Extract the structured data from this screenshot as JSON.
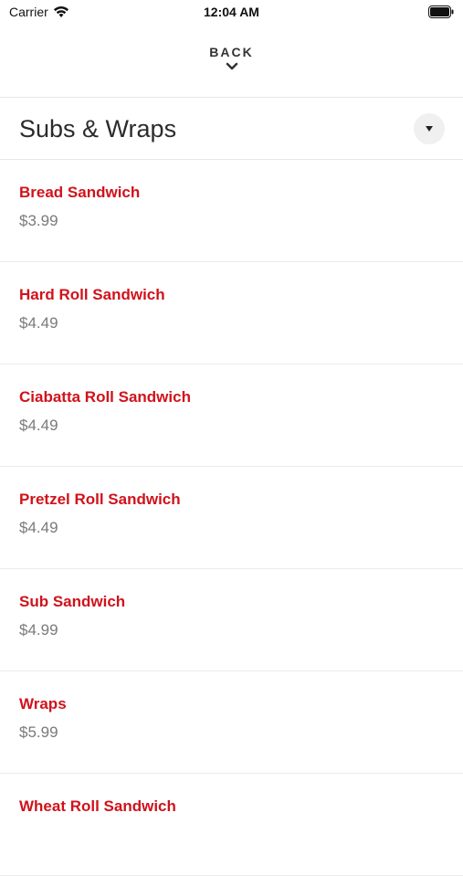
{
  "status_bar": {
    "carrier": "Carrier",
    "time": "12:04 AM"
  },
  "nav": {
    "back_label": "BACK"
  },
  "category": {
    "title": "Subs & Wraps"
  },
  "items": [
    {
      "name": "Bread Sandwich",
      "price": "$3.99"
    },
    {
      "name": "Hard Roll Sandwich",
      "price": "$4.49"
    },
    {
      "name": "Ciabatta Roll Sandwich",
      "price": "$4.49"
    },
    {
      "name": "Pretzel Roll Sandwich",
      "price": "$4.49"
    },
    {
      "name": "Sub Sandwich",
      "price": "$4.99"
    },
    {
      "name": "Wraps",
      "price": "$5.99"
    },
    {
      "name": "Wheat Roll Sandwich",
      "price": ""
    }
  ],
  "colors": {
    "accent": "#d0121b",
    "price": "#7a7a7a",
    "title": "#2b2b2b"
  },
  "icons": {
    "wifi": "wifi-icon",
    "battery": "battery-icon",
    "back": "chevron-down-icon",
    "dropdown": "caret-down-icon"
  }
}
